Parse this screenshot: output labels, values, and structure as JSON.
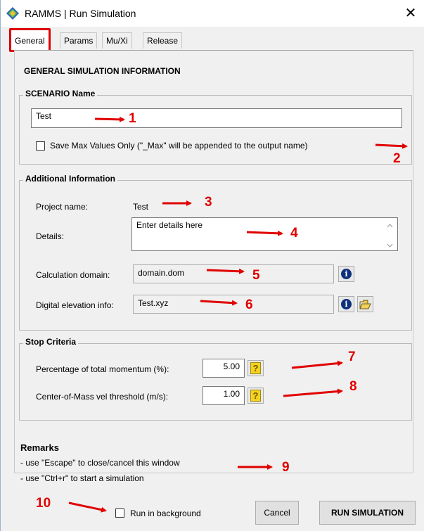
{
  "window": {
    "title": "RAMMS | Run Simulation",
    "close_symbol": "✕"
  },
  "tabs": [
    {
      "label": "General",
      "active": true
    },
    {
      "label": "Params"
    },
    {
      "label": "Mu/Xi"
    },
    {
      "label": "Release"
    }
  ],
  "general": {
    "heading": "GENERAL SIMULATION INFORMATION",
    "scenario": {
      "legend": "SCENARIO Name",
      "name_value": "Test",
      "save_max_label": "Save Max Values Only (\"_Max\" will be appended to the output name)",
      "save_max_checked": false
    },
    "additional": {
      "legend": "Additional Information",
      "project_name_label": "Project name:",
      "project_name_value": "Test",
      "details_label": "Details:",
      "details_placeholder": "Enter details here",
      "calc_domain_label": "Calculation domain:",
      "calc_domain_value": "domain.dom",
      "dem_label": "Digital elevation info:",
      "dem_value": "Test.xyz"
    },
    "stop": {
      "legend": "Stop Criteria",
      "momentum_label": "Percentage of total momentum (%):",
      "momentum_value": "5.00",
      "com_label": "Center-of-Mass vel threshold (m/s):",
      "com_value": "1.00",
      "help_glyph": "?"
    },
    "remarks": {
      "title": "Remarks",
      "line1": "- use \"Escape\" to close/cancel this window",
      "line2": "- use \"Ctrl+r\" to start a simulation"
    }
  },
  "footer": {
    "run_background_label": "Run in background",
    "run_background_checked": false,
    "cancel_label": "Cancel",
    "run_label": "RUN SIMULATION"
  },
  "annotations": [
    "1",
    "2",
    "3",
    "4",
    "5",
    "6",
    "7",
    "8",
    "9",
    "10"
  ],
  "colors": {
    "annotation": "#e00000",
    "info_icon": "#0e2f7c",
    "help_icon_fill": "#f4d21f"
  },
  "icons": {
    "app": "ramms-logo-icon",
    "info": "info-icon",
    "folder": "open-folder-icon",
    "help": "help-question-icon"
  }
}
